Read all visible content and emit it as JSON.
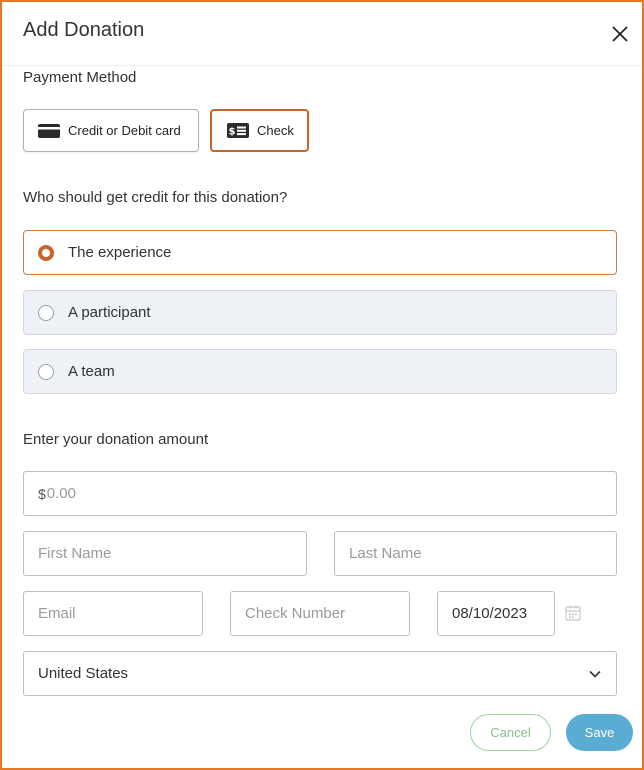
{
  "dialog": {
    "title": "Add Donation"
  },
  "payment": {
    "label": "Payment Method",
    "options": [
      {
        "label": "Credit or Debit card",
        "icon": "credit-card-icon",
        "selected": false
      },
      {
        "label": "Check",
        "icon": "check-bill-icon",
        "selected": true
      }
    ]
  },
  "credit": {
    "question": "Who should get credit for this donation?",
    "options": [
      {
        "label": "The experience",
        "selected": true
      },
      {
        "label": "A participant",
        "selected": false
      },
      {
        "label": "A team",
        "selected": false
      }
    ]
  },
  "amount": {
    "label": "Enter your donation amount",
    "prefix": "$",
    "placeholder": "0.00"
  },
  "fields": {
    "first_name_placeholder": "First Name",
    "last_name_placeholder": "Last Name",
    "email_placeholder": "Email",
    "check_number_placeholder": "Check Number",
    "date_value": "08/10/2023"
  },
  "country": {
    "selected": "United States"
  },
  "actions": {
    "cancel_label": "Cancel",
    "save_label": "Save"
  },
  "colors": {
    "accent": "#c8652d",
    "frame": "#e87722",
    "save": "#5aacd3",
    "cancel": "#8ac08c"
  }
}
